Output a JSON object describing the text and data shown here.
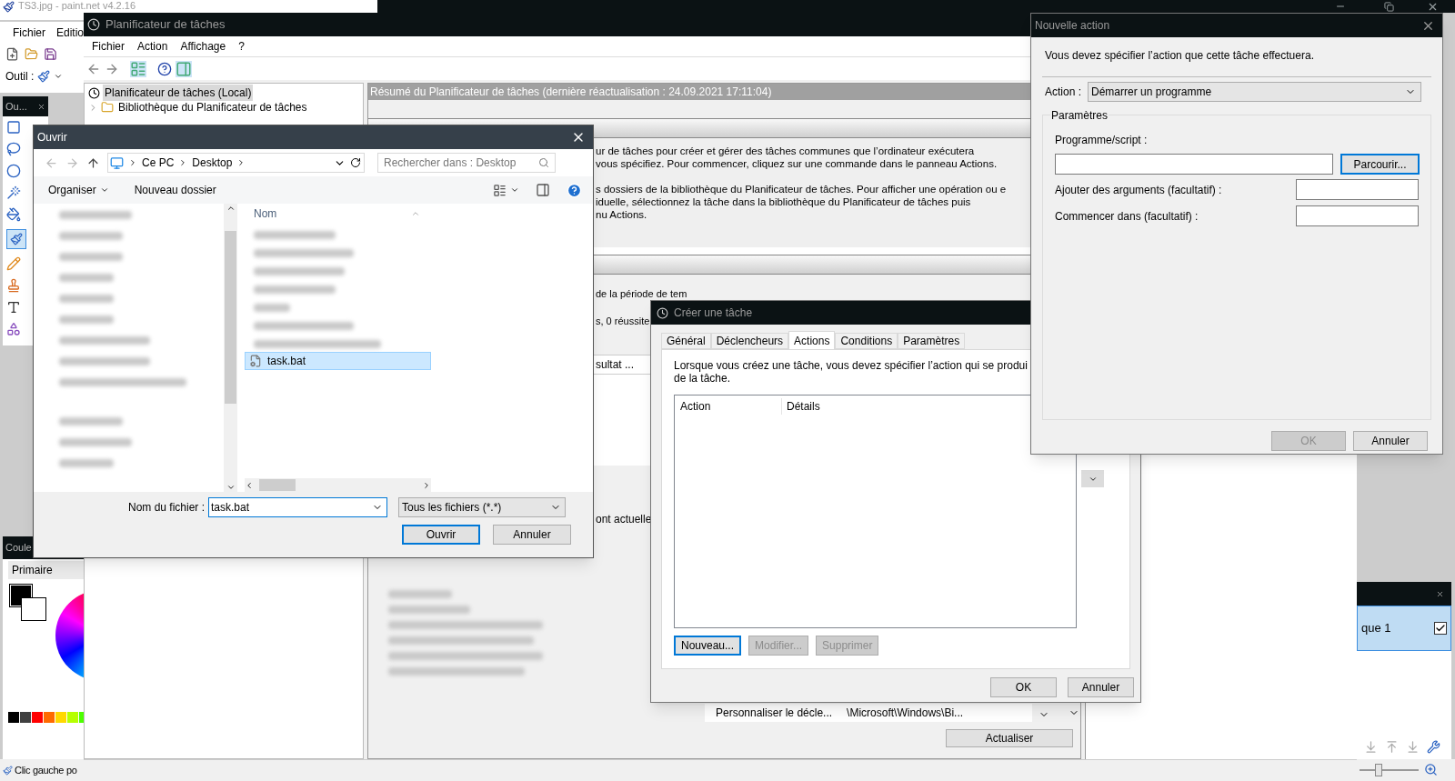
{
  "paint": {
    "title": "TS3.jpg - paint.net v4.2.16",
    "menu": [
      "Fichier",
      "Editio"
    ],
    "tool_label": "Outil :",
    "tools_title": "Ou...",
    "colors_title": "Coule",
    "color_tab": "Primaire",
    "layer": {
      "name": "que 1",
      "visible": true
    },
    "status": "Clic gauche po",
    "zoom": {
      "level": 0.3
    }
  },
  "scheduler": {
    "title": "Planificateur de tâches",
    "menu": [
      "Fichier",
      "Action",
      "Affichage",
      "?"
    ],
    "tree": [
      {
        "label": "Planificateur de tâches (Local)",
        "selected": true
      },
      {
        "label": "Bibliothèque du Planificateur de tâches",
        "selected": false,
        "expanded": false
      }
    ],
    "summary": "Résumé du Planificateur de tâches (dernière réactualisation : 24.09.2021 17:11:04)",
    "overview": [
      "ur de tâches pour créer et gérer des tâches communes que l’ordinateur exécutera",
      "vous spécifiez. Pour commencer, cliquez sur une commande dans le panneau Actions."
    ],
    "library_text": [
      "s dossiers de la bibliothèque du Planificateur de tâches. Pour afficher une opération ou e",
      "iduelle, sélectionnez la tâche dans la bibliothèque du Planificateur de tâches puis",
      "nu Actions."
    ],
    "status_lines": [
      "de la période de tem",
      "s, 0 réussite"
    ],
    "column_fragment": "sultat ...",
    "active_fragment": "ont actuelle",
    "task_row": [
      "Personnaliser le décle...",
      "\\Microsoft\\Windows\\Bi..."
    ],
    "refresh": "Actualiser"
  },
  "open_dialog": {
    "title": "Ouvrir",
    "path": [
      "Ce PC",
      "Desktop"
    ],
    "search_placeholder": "Rechercher dans : Desktop",
    "organize": "Organiser",
    "new_folder": "Nouveau dossier",
    "column": "Nom",
    "files": [
      {
        "name": "task.bat",
        "selected": true
      }
    ],
    "filename_label": "Nom du fichier :",
    "filename": "task.bat",
    "filter": "Tous les fichiers (*.*)",
    "buttons": [
      "Ouvrir",
      "Annuler"
    ]
  },
  "create_task": {
    "title": "Créer une tâche",
    "tabs": [
      {
        "label": "Général",
        "selected": false
      },
      {
        "label": "Déclencheurs",
        "selected": false
      },
      {
        "label": "Actions",
        "selected": true
      },
      {
        "label": "Conditions",
        "selected": false
      },
      {
        "label": "Paramètres",
        "selected": false
      }
    ],
    "description": [
      "Lorsque vous créez une tâche, vous devez spécifier l’action qui se produi",
      "de la tâche."
    ],
    "columns": [
      "Action",
      "Détails"
    ],
    "buttons": [
      {
        "label": "Nouveau...",
        "disabled": false
      },
      {
        "label": "Modifier...",
        "disabled": true
      },
      {
        "label": "Supprimer",
        "disabled": true
      }
    ],
    "footer": [
      "OK",
      "Annuler"
    ]
  },
  "new_action": {
    "title": "Nouvelle action",
    "instruction": "Vous devez spécifier l’action que cette tâche effectuera.",
    "action_label": "Action :",
    "action_value": "Démarrer un programme",
    "group": "Paramètres",
    "program_label": "Programme/script :",
    "browse": "Parcourir...",
    "fields": [
      "Ajouter des arguments (facultatif) :",
      "Commencer dans (facultatif) :"
    ],
    "buttons": [
      {
        "label": "OK",
        "disabled": true
      },
      {
        "label": "Annuler",
        "disabled": false
      }
    ]
  }
}
